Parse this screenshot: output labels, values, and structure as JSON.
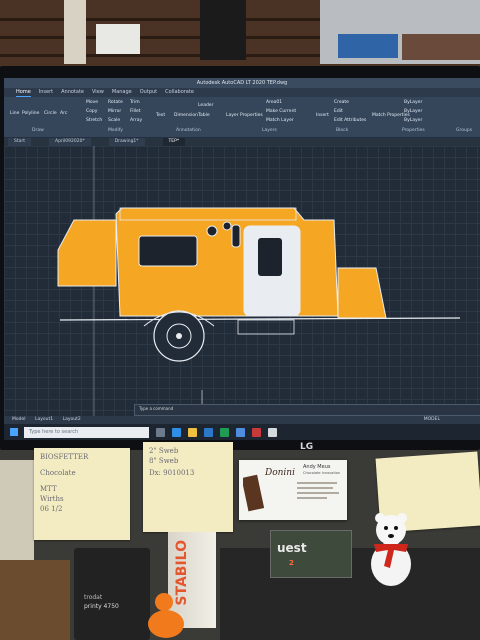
{
  "colors": {
    "trailer_body": "#f5a623",
    "door": "#e9edf2",
    "drawing_bg": "#222b38",
    "ribbon": "#35465b",
    "sticky_note": "#f3ecc2"
  },
  "autocad": {
    "title": "Autodesk AutoCAD LT 2020  TEP.dwg",
    "ribbon_tabs": [
      "Home",
      "Insert",
      "Annotate",
      "View",
      "Manage",
      "Output",
      "Collaborate"
    ],
    "active_tab": "Home",
    "draw_tools": [
      "Line",
      "Polyline",
      "Circle",
      "Arc"
    ],
    "modify_tools": [
      "Move",
      "Rotate",
      "Trim",
      "Copy",
      "Mirror",
      "Fillet",
      "Stretch",
      "Scale",
      "Array"
    ],
    "annotation_tools": [
      "Text",
      "Dimension",
      "Leader",
      "Table"
    ],
    "layer_tools": [
      "Layer Properties",
      "Make Current",
      "Match Layer"
    ],
    "block_tools": [
      "Create",
      "Edit",
      "Edit Attributes",
      "Insert"
    ],
    "properties_tools": [
      "Match Properties",
      "ByLayer",
      "ByLayer",
      "ByLayer"
    ],
    "panel_labels": [
      "Draw",
      "Modify",
      "Annotation",
      "Layers",
      "Block",
      "Properties",
      "Groups"
    ],
    "doc_tabs": [
      "Start",
      "April092020*",
      "Drawing1*",
      "TEP*"
    ],
    "active_doc": "TEP*",
    "layer_name": "Area01",
    "command_prompt": "Type a command",
    "layout_tabs": [
      "Model",
      "Layout1",
      "Layout2"
    ],
    "model_label": "MODEL",
    "search_placeholder": "Type here to search"
  },
  "monitor_brand": "LG",
  "notes": {
    "left": [
      "BIOSFETTER",
      "Chocolate",
      "MTT",
      "Wirths",
      "06 1/2"
    ],
    "middle": [
      "2\" Sweb",
      "8\" Sweb",
      "Dx: 9010013"
    ],
    "right": [
      "",
      ""
    ]
  },
  "business_card": {
    "logo": "Donini",
    "name": "Andy Meus",
    "subtitle": "Chocolate Innovation"
  },
  "stamp": {
    "brand": "trodat",
    "model": "printy 4750"
  },
  "marker_box": "STABILO",
  "badge": {
    "text": "uest",
    "number": "2"
  }
}
